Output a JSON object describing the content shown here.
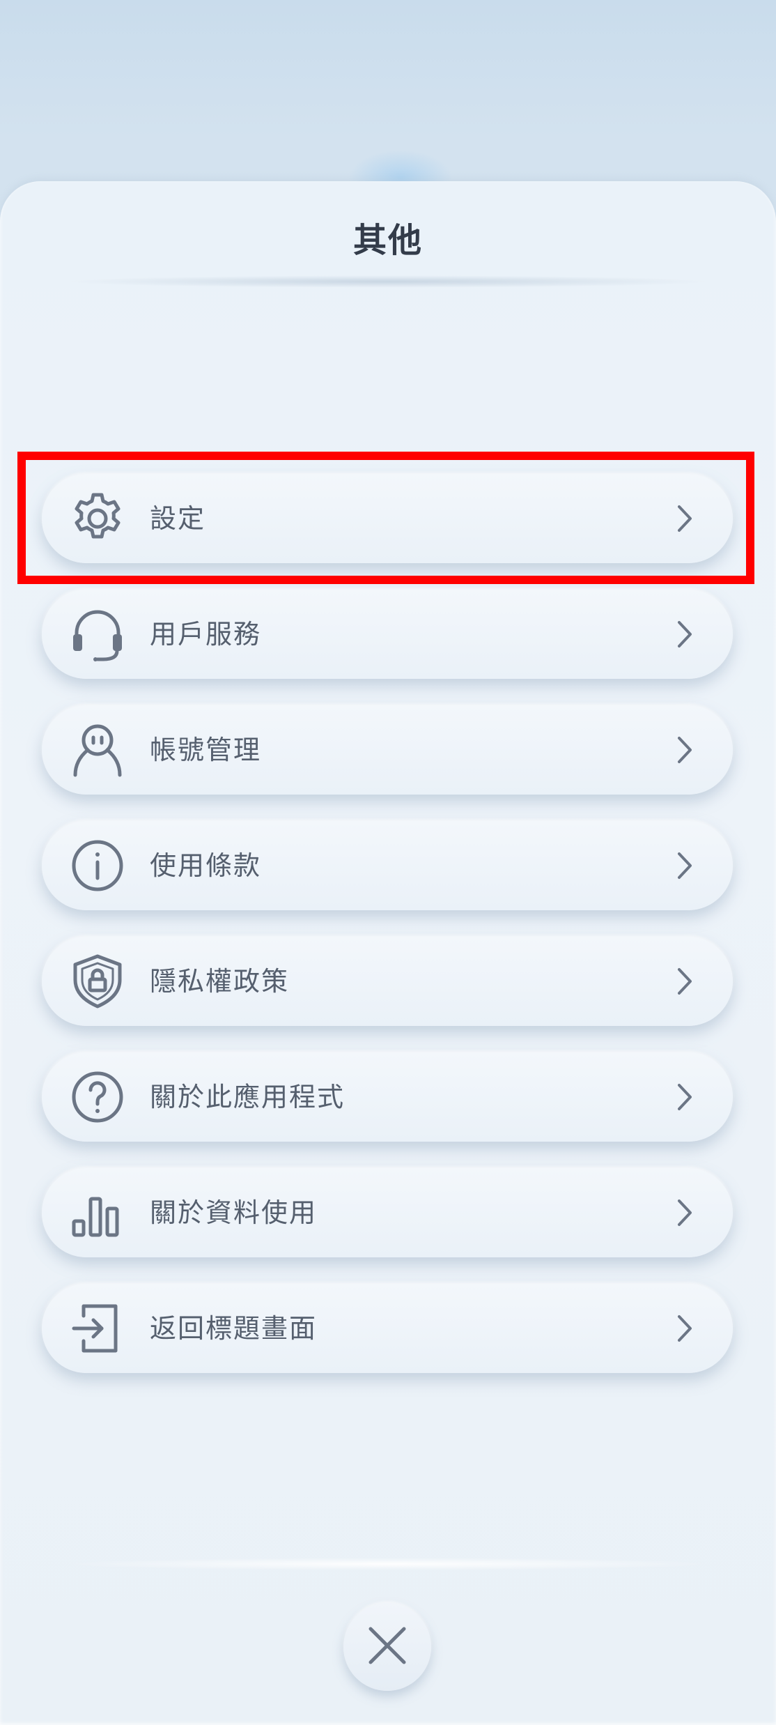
{
  "sheet": {
    "title": "其他"
  },
  "menu": {
    "items": [
      {
        "label": "設定",
        "icon": "gear-icon"
      },
      {
        "label": "用戶服務",
        "icon": "headset-icon"
      },
      {
        "label": "帳號管理",
        "icon": "user-icon"
      },
      {
        "label": "使用條款",
        "icon": "info-icon"
      },
      {
        "label": "隱私權政策",
        "icon": "shield-lock-icon"
      },
      {
        "label": "關於此應用程式",
        "icon": "question-icon"
      },
      {
        "label": "關於資料使用",
        "icon": "bar-chart-icon"
      },
      {
        "label": "返回標題畫面",
        "icon": "exit-icon"
      }
    ],
    "chevron_icon": "chevron-right-icon"
  },
  "close": {
    "icon": "close-icon"
  },
  "colors": {
    "highlight": "#ff0000",
    "icon": "#6b7585",
    "label": "#555f6e",
    "title": "#333c4a"
  }
}
